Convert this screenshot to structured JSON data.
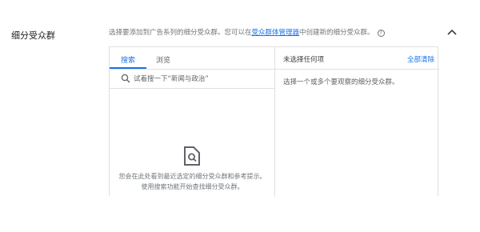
{
  "section": {
    "title": "细分受众群",
    "description_prefix": "选择要添加到广告系列的细分受众群。您可以在",
    "description_link": "受众群体管理器",
    "description_suffix": "中创建新的细分受众群。",
    "help_icon": "help-circle-icon",
    "collapse_icon": "chevron-up-icon"
  },
  "left_panel": {
    "tabs": [
      {
        "label": "搜索",
        "active": true
      },
      {
        "label": "浏览",
        "active": false
      }
    ],
    "search": {
      "icon": "search-icon",
      "value": "",
      "placeholder": "试着搜一下“新闻与政治”"
    },
    "empty_state": {
      "icon": "document-search-icon",
      "line1": "您会在此处看到最近选定的细分受众群和参考提示。",
      "line2": "使用搜索功能开始查找细分受众群。"
    }
  },
  "right_panel": {
    "none_selected_label": "未选择任何项",
    "clear_all_label": "全部清除",
    "hint": "选择一个或多个要观察的细分受众群。"
  },
  "colors": {
    "accent": "#1a73e8",
    "text_primary": "#202124",
    "text_secondary": "#5f6368",
    "border": "#e0e0e0"
  }
}
